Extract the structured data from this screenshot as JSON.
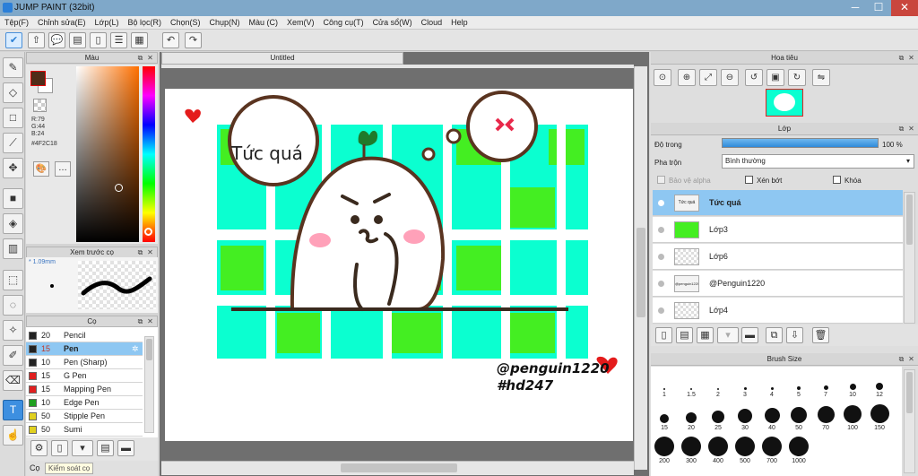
{
  "window": {
    "title": "JUMP PAINT (32bit)",
    "min": "─",
    "max": "☐",
    "close": "✕"
  },
  "menu": [
    "Tệp(F)",
    "Chỉnh sửa(E)",
    "Lớp(L)",
    "Bộ lọc(R)",
    "Chọn(S)",
    "Chụp(N)",
    "Màu (C)",
    "Xem(V)",
    "Công cụ(T)",
    "Cửa sổ(W)",
    "Cloud",
    "Help"
  ],
  "color_panel": {
    "title": "Màu",
    "r": "R:79",
    "g": "G:44",
    "b": "B:24",
    "hex": "#4F2C18",
    "current_color": "#4F2C18"
  },
  "preview_panel": {
    "title": "Xem trước cọ",
    "size": "* 1.09mm"
  },
  "brush_panel": {
    "title": "Cọ",
    "brushes": [
      {
        "size": "20",
        "name": "Pencil",
        "color": "#222222"
      },
      {
        "size": "15",
        "name": "Pen",
        "color": "#e02020",
        "selected": true
      },
      {
        "size": "10",
        "name": "Pen (Sharp)",
        "color": "#222222"
      },
      {
        "size": "15",
        "name": "G Pen",
        "color": "#e02020"
      },
      {
        "size": "15",
        "name": "Mapping Pen",
        "color": "#e02020"
      },
      {
        "size": "10",
        "name": "Edge Pen",
        "color": "#20a020"
      },
      {
        "size": "50",
        "name": "Stipple Pen",
        "color": "#e0d020"
      },
      {
        "size": "50",
        "name": "Sumi",
        "color": "#e0d020"
      }
    ]
  },
  "left_status": {
    "tab1": "Cọ",
    "tab2": "Kiểm soát cọ"
  },
  "document": {
    "tab": "Untitled"
  },
  "artwork": {
    "bubble_left": "Tức quá",
    "credit_line1": "@penguin1220",
    "credit_line2": "#hd247"
  },
  "navigator": {
    "title": "Hoa tiêu"
  },
  "layer_panel": {
    "title": "Lớp",
    "opacity_label": "Độ trong",
    "opacity_value": "100 %",
    "opacity_fraction": 1.0,
    "blend_label": "Pha trộn",
    "blend_value": "Bình thường",
    "protect_alpha": "Bảo vệ alpha",
    "clipping": "Xén bớt",
    "lock": "Khóa",
    "layers": [
      {
        "name": "Tức quá",
        "thumb_text": "Tức quá",
        "selected": true
      },
      {
        "name": "Lớp3"
      },
      {
        "name": "Lớp6"
      },
      {
        "name": "@Penguin1220",
        "thumb_text": "@penguin1220"
      },
      {
        "name": "Lớp4"
      }
    ]
  },
  "brush_size_panel": {
    "title": "Brush Size",
    "sizes": [
      "1",
      "1.5",
      "2",
      "3",
      "4",
      "5",
      "7",
      "10",
      "12",
      "15",
      "20",
      "25",
      "30",
      "40",
      "50",
      "70",
      "100",
      "150",
      "200",
      "300",
      "400",
      "500",
      "700",
      "1000"
    ]
  }
}
